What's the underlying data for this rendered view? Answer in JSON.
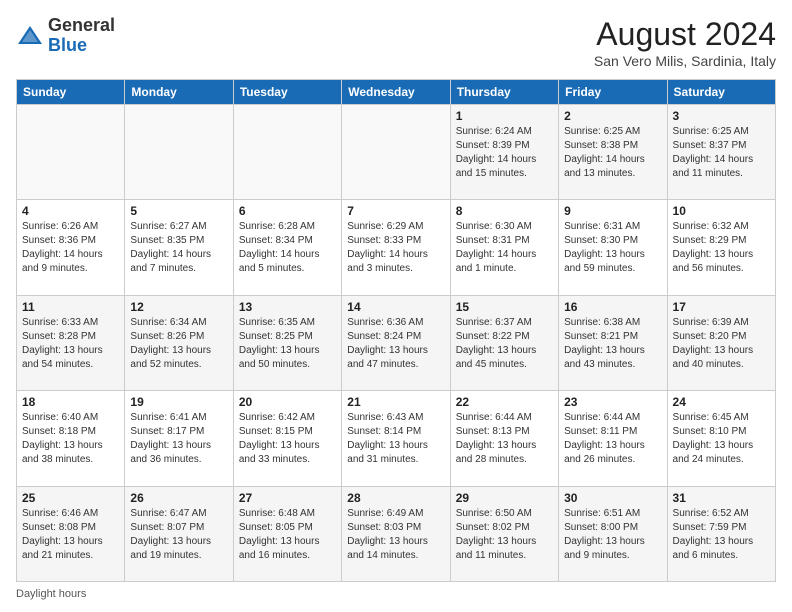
{
  "header": {
    "logo_general": "General",
    "logo_blue": "Blue",
    "month_year": "August 2024",
    "location": "San Vero Milis, Sardinia, Italy"
  },
  "days_of_week": [
    "Sunday",
    "Monday",
    "Tuesday",
    "Wednesday",
    "Thursday",
    "Friday",
    "Saturday"
  ],
  "footer": {
    "note": "Daylight hours"
  },
  "weeks": [
    {
      "days": [
        {
          "num": "",
          "info": ""
        },
        {
          "num": "",
          "info": ""
        },
        {
          "num": "",
          "info": ""
        },
        {
          "num": "",
          "info": ""
        },
        {
          "num": "1",
          "info": "Sunrise: 6:24 AM\nSunset: 8:39 PM\nDaylight: 14 hours\nand 15 minutes."
        },
        {
          "num": "2",
          "info": "Sunrise: 6:25 AM\nSunset: 8:38 PM\nDaylight: 14 hours\nand 13 minutes."
        },
        {
          "num": "3",
          "info": "Sunrise: 6:25 AM\nSunset: 8:37 PM\nDaylight: 14 hours\nand 11 minutes."
        }
      ]
    },
    {
      "days": [
        {
          "num": "4",
          "info": "Sunrise: 6:26 AM\nSunset: 8:36 PM\nDaylight: 14 hours\nand 9 minutes."
        },
        {
          "num": "5",
          "info": "Sunrise: 6:27 AM\nSunset: 8:35 PM\nDaylight: 14 hours\nand 7 minutes."
        },
        {
          "num": "6",
          "info": "Sunrise: 6:28 AM\nSunset: 8:34 PM\nDaylight: 14 hours\nand 5 minutes."
        },
        {
          "num": "7",
          "info": "Sunrise: 6:29 AM\nSunset: 8:33 PM\nDaylight: 14 hours\nand 3 minutes."
        },
        {
          "num": "8",
          "info": "Sunrise: 6:30 AM\nSunset: 8:31 PM\nDaylight: 14 hours\nand 1 minute."
        },
        {
          "num": "9",
          "info": "Sunrise: 6:31 AM\nSunset: 8:30 PM\nDaylight: 13 hours\nand 59 minutes."
        },
        {
          "num": "10",
          "info": "Sunrise: 6:32 AM\nSunset: 8:29 PM\nDaylight: 13 hours\nand 56 minutes."
        }
      ]
    },
    {
      "days": [
        {
          "num": "11",
          "info": "Sunrise: 6:33 AM\nSunset: 8:28 PM\nDaylight: 13 hours\nand 54 minutes."
        },
        {
          "num": "12",
          "info": "Sunrise: 6:34 AM\nSunset: 8:26 PM\nDaylight: 13 hours\nand 52 minutes."
        },
        {
          "num": "13",
          "info": "Sunrise: 6:35 AM\nSunset: 8:25 PM\nDaylight: 13 hours\nand 50 minutes."
        },
        {
          "num": "14",
          "info": "Sunrise: 6:36 AM\nSunset: 8:24 PM\nDaylight: 13 hours\nand 47 minutes."
        },
        {
          "num": "15",
          "info": "Sunrise: 6:37 AM\nSunset: 8:22 PM\nDaylight: 13 hours\nand 45 minutes."
        },
        {
          "num": "16",
          "info": "Sunrise: 6:38 AM\nSunset: 8:21 PM\nDaylight: 13 hours\nand 43 minutes."
        },
        {
          "num": "17",
          "info": "Sunrise: 6:39 AM\nSunset: 8:20 PM\nDaylight: 13 hours\nand 40 minutes."
        }
      ]
    },
    {
      "days": [
        {
          "num": "18",
          "info": "Sunrise: 6:40 AM\nSunset: 8:18 PM\nDaylight: 13 hours\nand 38 minutes."
        },
        {
          "num": "19",
          "info": "Sunrise: 6:41 AM\nSunset: 8:17 PM\nDaylight: 13 hours\nand 36 minutes."
        },
        {
          "num": "20",
          "info": "Sunrise: 6:42 AM\nSunset: 8:15 PM\nDaylight: 13 hours\nand 33 minutes."
        },
        {
          "num": "21",
          "info": "Sunrise: 6:43 AM\nSunset: 8:14 PM\nDaylight: 13 hours\nand 31 minutes."
        },
        {
          "num": "22",
          "info": "Sunrise: 6:44 AM\nSunset: 8:13 PM\nDaylight: 13 hours\nand 28 minutes."
        },
        {
          "num": "23",
          "info": "Sunrise: 6:44 AM\nSunset: 8:11 PM\nDaylight: 13 hours\nand 26 minutes."
        },
        {
          "num": "24",
          "info": "Sunrise: 6:45 AM\nSunset: 8:10 PM\nDaylight: 13 hours\nand 24 minutes."
        }
      ]
    },
    {
      "days": [
        {
          "num": "25",
          "info": "Sunrise: 6:46 AM\nSunset: 8:08 PM\nDaylight: 13 hours\nand 21 minutes."
        },
        {
          "num": "26",
          "info": "Sunrise: 6:47 AM\nSunset: 8:07 PM\nDaylight: 13 hours\nand 19 minutes."
        },
        {
          "num": "27",
          "info": "Sunrise: 6:48 AM\nSunset: 8:05 PM\nDaylight: 13 hours\nand 16 minutes."
        },
        {
          "num": "28",
          "info": "Sunrise: 6:49 AM\nSunset: 8:03 PM\nDaylight: 13 hours\nand 14 minutes."
        },
        {
          "num": "29",
          "info": "Sunrise: 6:50 AM\nSunset: 8:02 PM\nDaylight: 13 hours\nand 11 minutes."
        },
        {
          "num": "30",
          "info": "Sunrise: 6:51 AM\nSunset: 8:00 PM\nDaylight: 13 hours\nand 9 minutes."
        },
        {
          "num": "31",
          "info": "Sunrise: 6:52 AM\nSunset: 7:59 PM\nDaylight: 13 hours\nand 6 minutes."
        }
      ]
    }
  ]
}
